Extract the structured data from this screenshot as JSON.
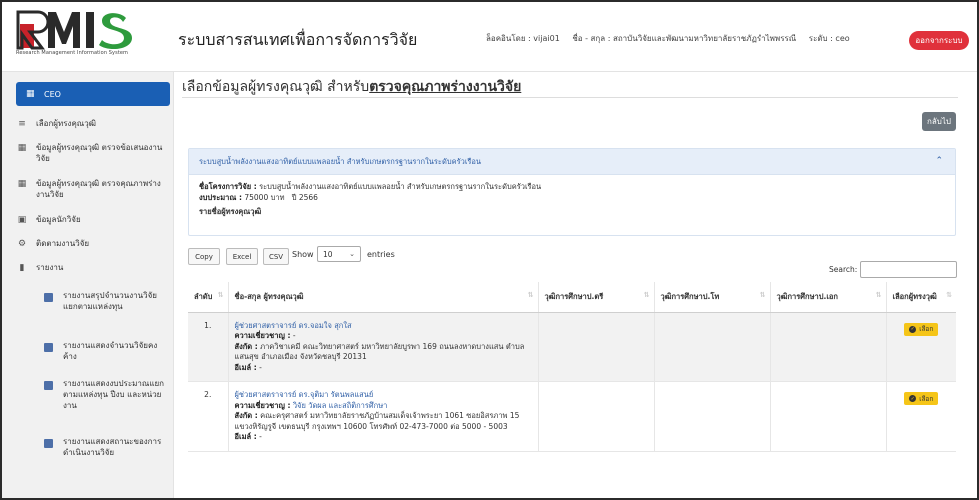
{
  "header": {
    "logo_text_main": "RMIS",
    "logo_text_sub": "Research Management Information System",
    "system_title": "ระบบสารสนเทศเพื่อการจัดการวิจัย",
    "login_by": "ล็อคอินโดย : vijai01",
    "user_name": "ชื่อ - สกุล : สถาบันวิจัยและพัฒนามหาวิทยาลัยราชภัฏรำไพพรรณี",
    "level": "ระดับ : ceo",
    "logout_label": "ออกจากระบบ"
  },
  "sidebar": {
    "active": "CEO",
    "items": [
      {
        "label": "เลือกผู้ทรงคุณวุฒิ"
      },
      {
        "label": "ข้อมูลผู้ทรงคุณวุฒิ ตรวจข้อเสนองานวิจัย"
      },
      {
        "label": "ข้อมูลผู้ทรงคุณวุฒิ ตรวจคุณภาพร่างงานวิจัย"
      },
      {
        "label": "ข้อมูลนักวิจัย"
      },
      {
        "label": "ติดตามงานวิจัย"
      },
      {
        "label": "รายงาน"
      }
    ],
    "sub_items": [
      {
        "label": "รายงานสรุปจำนวนงานวิจัยแยกตามแหล่งทุน"
      },
      {
        "label": "รายงานแสดงจำนวนวิจัยคงค้าง"
      },
      {
        "label": "รายงานแสดงงบประมาณแยกตามแหล่งทุน ปีงบ และหน่วยงาน"
      },
      {
        "label": "รายงานแสดงสถานะของการดำเนินงานวิจัย"
      }
    ]
  },
  "main": {
    "page_title_prefix": "เลือกข้อมูลผู้ทรงคุณวุฒิ สำหรับ",
    "page_title_emph": "ตรวจคุณภาพร่างงานวิจัย",
    "back_label": "กลับไป",
    "project": {
      "header_title": "ระบบสูบน้ำพลังงานแสงอาทิตย์แบบแพลอยน้ำ สำหรับเกษตรกรฐานรากในระดับครัวเรือน",
      "name_label": "ชื่อโครงการวิจัย :",
      "name_value": "ระบบสูบน้ำพลังงานแสงอาทิตย์แบบแพลอยน้ำ สำหรับเกษตรกรฐานรากในระดับครัวเรือน",
      "budget_label": "งบประมาณ :",
      "budget_value": "75000 บาท",
      "year_value": "ปี 2566",
      "experts_heading": "รายชื่อผู้ทรงคุณวุฒิ"
    },
    "toolbar": {
      "copy_label": "Copy",
      "excel_label": "Excel",
      "csv_label": "CSV",
      "show_label": "Show",
      "page_size": "10",
      "entries_label": "entries",
      "search_label": "Search:",
      "search_value": ""
    },
    "table": {
      "columns": [
        "ลำดับ",
        "ชื่อ-สกุล ผู้ทรงคุณวุฒิ",
        "วุฒิการศึกษาป.ตรี",
        "วุฒิการศึกษาป.โท",
        "วุฒิการศึกษาป.เอก",
        "เลือกผู้ทรงวุฒิ"
      ],
      "expertise_label": "ความเชี่ยวชาญ :",
      "affiliation_label": "สังกัด :",
      "email_label": "อีเมล์ :",
      "select_label": "เลือก",
      "rows": [
        {
          "no": "1.",
          "name": "ผู้ช่วยศาสตราจารย์ ดร.จอมใจ สุกใส",
          "expertise": "-",
          "affiliation": "ภาควิชาเคมี คณะวิทยาศาสตร์ มหาวิทยาลัยบูรพา 169 ถนนลงหาดบางแสน ตำบลแสนสุข อำเภอเมือง จังหวัดชลบุรี 20131",
          "email": "-",
          "bachelor": "",
          "master": "",
          "doctorate": ""
        },
        {
          "no": "2.",
          "name": "ผู้ช่วยศาสตราจารย์ ดร.จุติมา รัตนพลแสนย์",
          "expertise": "วิจัย วัดผล และสถิติการศึกษา",
          "affiliation": "คณะครุศาสตร์ มหาวิทยาลัยราชภัฏบ้านสมเด็จเจ้าพระยา 1061 ซอยอิสรภาพ 15 แขวงหิรัญรูจี เขตธนบุรี กรุงเทพฯ 10600 โทรศัพท์ 02-473-7000 ต่อ 5000 - 5003",
          "email": "-",
          "bachelor": "",
          "master": "",
          "doctorate": ""
        }
      ]
    }
  }
}
